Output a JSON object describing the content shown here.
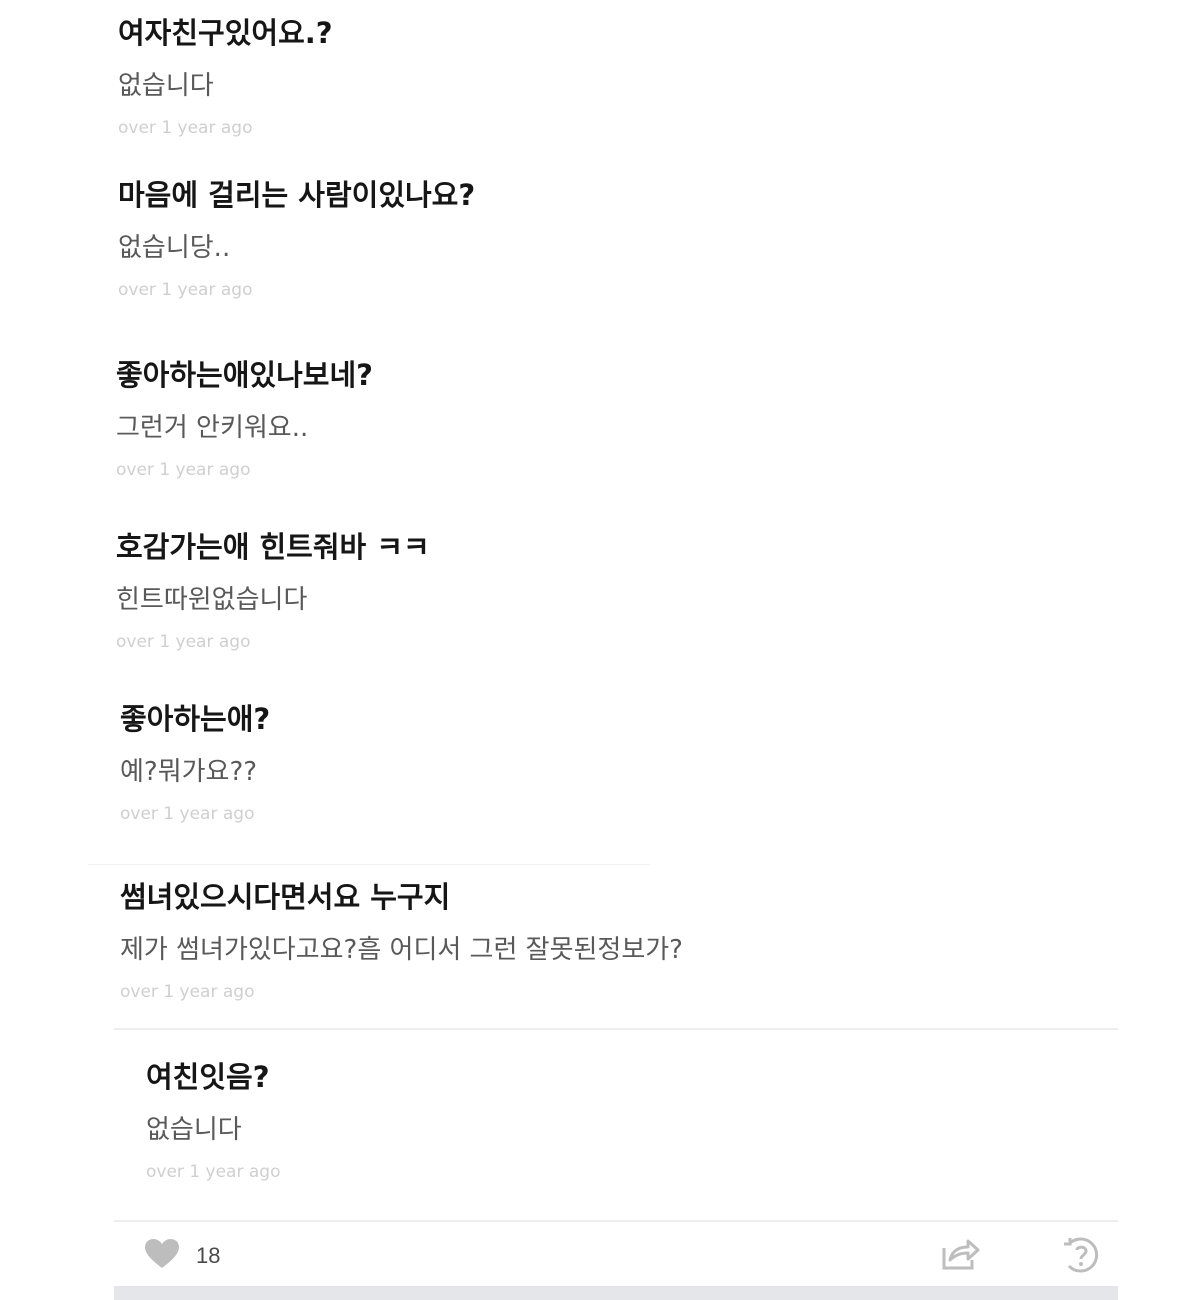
{
  "items": [
    {
      "question": "여자친구있어요.?",
      "answer": "없습니다",
      "time": "over 1 year ago"
    },
    {
      "question": "마음에 걸리는 사람이있나요?",
      "answer": "없습니당..",
      "time": "over 1 year ago"
    },
    {
      "question": "좋아하는애있나보네?",
      "answer": "그런거 안키워요..",
      "time": "over 1 year ago"
    },
    {
      "question": "호감가는애 힌트줘바 ㅋㅋ",
      "answer": "힌트따윈없습니다",
      "time": "over 1 year ago"
    },
    {
      "question": "좋아하는애?",
      "answer": "예?뭐가요??",
      "time": "over 1 year ago"
    },
    {
      "question": "썸녀있으시다면서요 누구지",
      "answer": "제가 썸녀가있다고요?흠 어디서 그런 잘못된정보가?",
      "time": "over 1 year ago"
    },
    {
      "question": "여친잇음?",
      "answer": "없습니다",
      "time": "over 1 year ago"
    }
  ],
  "footer": {
    "like_count": "18",
    "like_icon": "heart-icon",
    "share_icon": "share-icon",
    "help_icon": "question-circle-icon"
  },
  "colors": {
    "question_text": "#161616",
    "answer_text": "#595959",
    "time_text": "#cfcfcf",
    "icon_gray": "#bdbdbd",
    "bottom_bar": "#e4e6ea"
  }
}
